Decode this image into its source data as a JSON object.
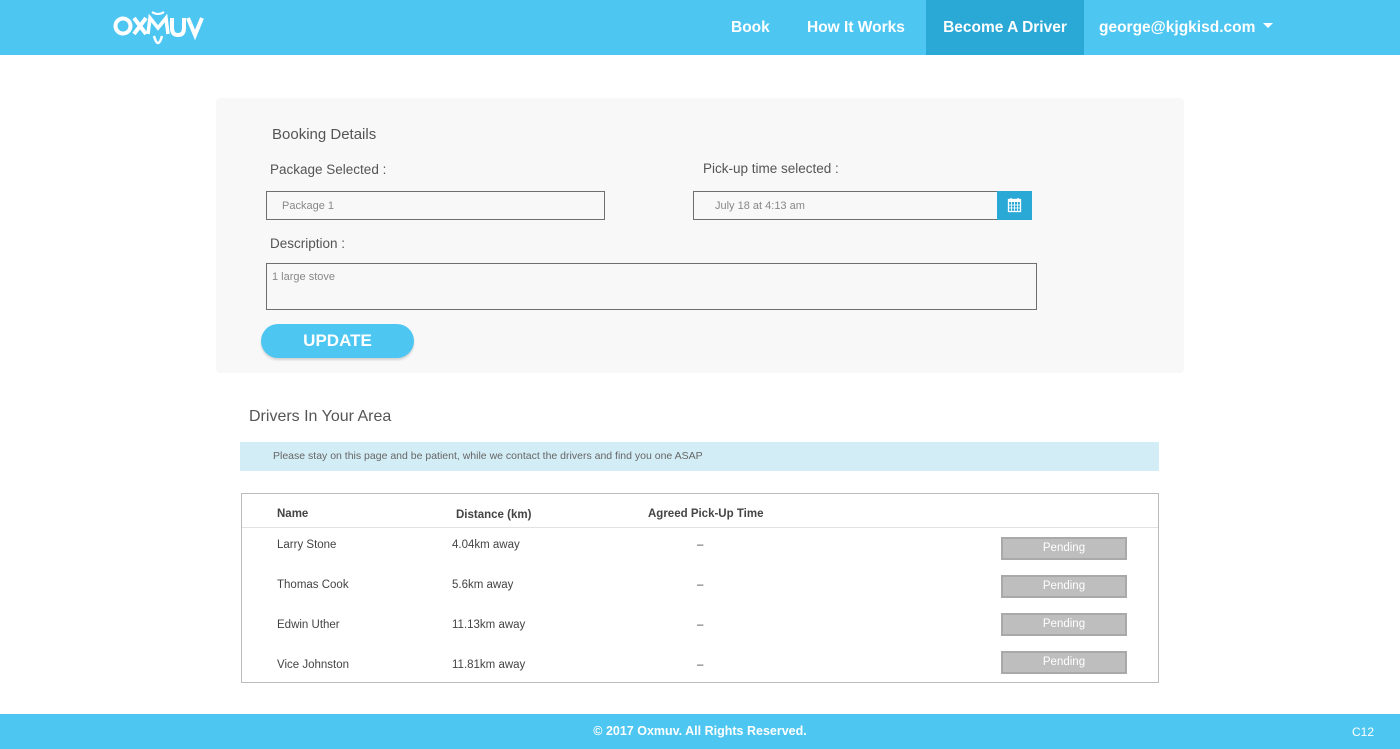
{
  "brand": {
    "logo_text": "OXMUV"
  },
  "nav": {
    "book": "Book",
    "how_it_works": "How It Works",
    "become_driver": "Become A Driver",
    "user_email": "george@kjgkisd.com"
  },
  "booking": {
    "title": "Booking Details",
    "package_label": "Package Selected :",
    "package_value": "Package 1",
    "pickup_label": "Pick-up time selected :",
    "pickup_value": "July 18 at 4:13 am",
    "description_label": "Description :",
    "description_value": "1 large stove",
    "update_button": "UPDATE"
  },
  "drivers": {
    "title": "Drivers In Your Area",
    "notice": "Please stay on this page and be patient, while we contact the drivers and find you one ASAP",
    "columns": [
      "Name",
      "Distance (km)",
      "Agreed Pick-Up Time"
    ],
    "rows": [
      {
        "name": "Larry Stone",
        "distance": "4.04km away",
        "time": "–",
        "status": "Pending"
      },
      {
        "name": "Thomas Cook",
        "distance": "5.6km away",
        "time": "–",
        "status": "Pending"
      },
      {
        "name": "Edwin Uther",
        "distance": "11.13km away",
        "time": "–",
        "status": "Pending"
      },
      {
        "name": "Vice Johnston",
        "distance": "11.81km away",
        "time": "–",
        "status": "Pending"
      }
    ]
  },
  "footer": {
    "copyright": "© 2017 Oxmuv. All Rights Reserved.",
    "badge": "C12"
  },
  "icons": {
    "calendar": "calendar-icon",
    "caret": "chevron-down-icon"
  },
  "colors": {
    "brand": "#4dc6f1",
    "brand_dark": "#2aa8d6",
    "notice_bg": "#d3edf6",
    "status_bg": "#bebebe"
  }
}
